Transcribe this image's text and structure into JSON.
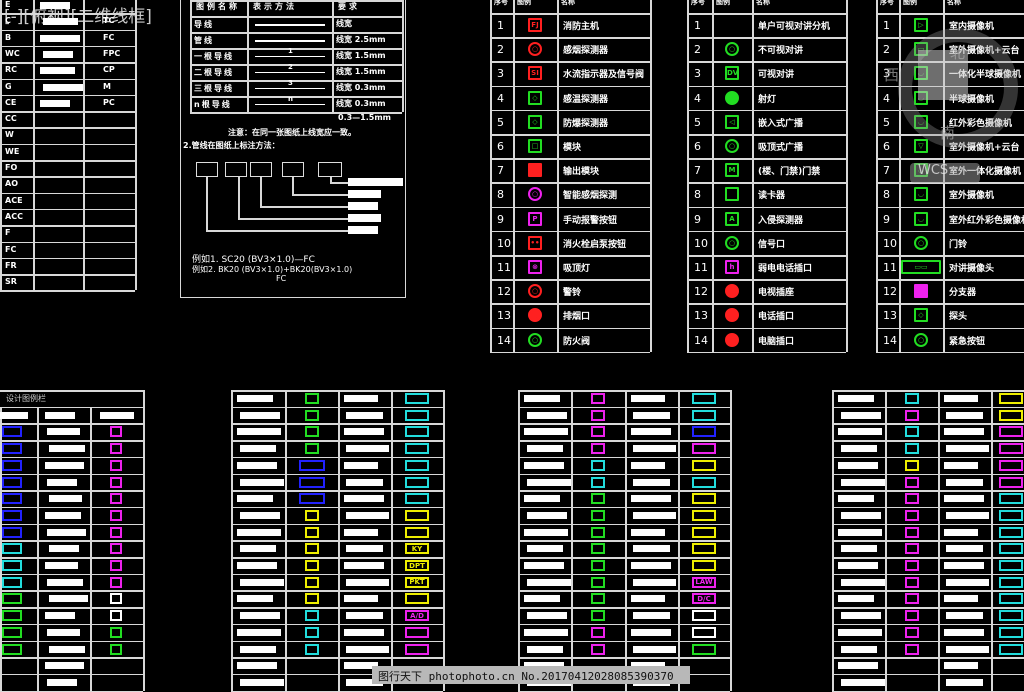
{
  "viewport_label": "[-][俯视][二维线框]",
  "code_table": {
    "left_codes": [
      "E",
      "C",
      "B",
      "WC",
      "RC",
      "G",
      "CE",
      "CC",
      "W",
      "WE",
      "FO",
      "AO",
      "ACE",
      "ACC",
      "F",
      "FC",
      "FR",
      "SR"
    ],
    "right_codes": [
      "",
      "TC",
      "FC",
      "FPC",
      "CP",
      "M",
      "PC"
    ]
  },
  "line_legend": {
    "headers": [
      "图例名称",
      "表示方法",
      "要求"
    ],
    "rows": [
      {
        "name": "导线",
        "req": "线宽"
      },
      {
        "name": "管线",
        "req": "线宽 2.5mm"
      },
      {
        "name": "一根导线",
        "req": "线宽 1.5mm"
      },
      {
        "name": "二根导线",
        "req": "线宽 1.5mm"
      },
      {
        "name": "三根导线",
        "req": "线宽 0.3mm"
      },
      {
        "name": "n根导线",
        "req": "线宽 0.3mm"
      }
    ],
    "row_marks": [
      "",
      "",
      "1",
      "2",
      "3",
      "n"
    ],
    "last_req": "0.3—1.5mm",
    "note": "注意：在同一张图纸上线宽应一致。",
    "section2": "2.管线在图纸上标注方法：",
    "example1": "例如1.  SC20 (BV3×1.0)—FC",
    "example2": "例如2.  BK20 (BV3×1.0)+BK20(BV3×1.0)",
    "example2_sub": "FC"
  },
  "legend_headers": [
    "序号",
    "图例",
    "名称"
  ],
  "legend_tables": [
    {
      "items": [
        {
          "n": "1",
          "name": "消防主机",
          "color": "#ff2020",
          "glyph": "FJ"
        },
        {
          "n": "2",
          "name": "感烟探测器",
          "color": "#ff2020",
          "glyph": "○"
        },
        {
          "n": "3",
          "name": "水流指示器及信号阀",
          "color": "#ff2020",
          "glyph": "SI"
        },
        {
          "n": "4",
          "name": "感温探测器",
          "color": "#22dd22",
          "glyph": "◇"
        },
        {
          "n": "5",
          "name": "防爆探测器",
          "color": "#22dd22",
          "glyph": "◇"
        },
        {
          "n": "6",
          "name": "模块",
          "color": "#22dd22",
          "glyph": "□"
        },
        {
          "n": "7",
          "name": "输出模块",
          "color": "#ff2020",
          "glyph": "■"
        },
        {
          "n": "8",
          "name": "智能感烟探测",
          "color": "#ee22ee",
          "glyph": "○"
        },
        {
          "n": "9",
          "name": "手动报警按钮",
          "color": "#ee22ee",
          "glyph": "P"
        },
        {
          "n": "10",
          "name": "消火栓启泵按钮",
          "color": "#ff2020",
          "glyph": "••"
        },
        {
          "n": "11",
          "name": "吸顶灯",
          "color": "#ee22ee",
          "glyph": "⊗"
        },
        {
          "n": "12",
          "name": "警铃",
          "color": "#ff2020",
          "glyph": "○"
        },
        {
          "n": "13",
          "name": "排烟口",
          "color": "#ff2020",
          "glyph": "●"
        },
        {
          "n": "14",
          "name": "防火阀",
          "color": "#22dd22",
          "glyph": "○"
        }
      ]
    },
    {
      "items": [
        {
          "n": "1",
          "name": "单户可视对讲分机",
          "color": "#22dd22",
          "glyph": ""
        },
        {
          "n": "2",
          "name": "不可视对讲",
          "color": "#22dd22",
          "glyph": "○"
        },
        {
          "n": "3",
          "name": "可视对讲",
          "color": "#22dd22",
          "glyph": "DV"
        },
        {
          "n": "4",
          "name": "射灯",
          "color": "#22dd22",
          "glyph": "●"
        },
        {
          "n": "5",
          "name": "嵌入式广播",
          "color": "#22dd22",
          "glyph": "◁"
        },
        {
          "n": "6",
          "name": "吸顶式广播",
          "color": "#22dd22",
          "glyph": "○"
        },
        {
          "n": "7",
          "name": "(楼、门禁)门禁",
          "color": "#22dd22",
          "glyph": "M"
        },
        {
          "n": "8",
          "name": "读卡器",
          "color": "#22dd22",
          "glyph": ""
        },
        {
          "n": "9",
          "name": "入侵探测器",
          "color": "#22dd22",
          "glyph": "A"
        },
        {
          "n": "10",
          "name": "信号口",
          "color": "#22dd22",
          "glyph": "○"
        },
        {
          "n": "11",
          "name": "弱电电话插口",
          "color": "#ee22ee",
          "glyph": "h"
        },
        {
          "n": "12",
          "name": "电视插座",
          "color": "#ff2020",
          "glyph": "●"
        },
        {
          "n": "13",
          "name": "电话插口",
          "color": "#ff2020",
          "glyph": "●"
        },
        {
          "n": "14",
          "name": "电脑插口",
          "color": "#ff2020",
          "glyph": "●"
        }
      ]
    },
    {
      "items": [
        {
          "n": "1",
          "name": "室内摄像机",
          "color": "#22dd22",
          "glyph": "▷"
        },
        {
          "n": "2",
          "name": "室外摄像机+云台",
          "color": "#22dd22",
          "glyph": "▭"
        },
        {
          "n": "3",
          "name": "一体化半球摄像机",
          "color": "#22dd22",
          "glyph": "◡"
        },
        {
          "n": "4",
          "name": "半球摄像机",
          "color": "#22dd22",
          "glyph": "◡"
        },
        {
          "n": "5",
          "name": "红外彩色摄像机",
          "color": "#22dd22",
          "glyph": "◡"
        },
        {
          "n": "6",
          "name": "室外摄像机+云台",
          "color": "#22dd22",
          "glyph": "▽"
        },
        {
          "n": "7",
          "name": "室外一体化摄像机",
          "color": "#22dd22",
          "glyph": "◡"
        },
        {
          "n": "8",
          "name": "室外摄像机",
          "color": "#22dd22",
          "glyph": "◡"
        },
        {
          "n": "9",
          "name": "室外红外彩色摄像机",
          "color": "#22dd22",
          "glyph": "◡"
        },
        {
          "n": "10",
          "name": "门铃",
          "color": "#22dd22",
          "glyph": "○"
        },
        {
          "n": "11",
          "name": "对讲摄像头",
          "color": "#22dd22",
          "glyph": "▭▭"
        },
        {
          "n": "12",
          "name": "分支器",
          "color": "#ee22ee",
          "glyph": "■"
        },
        {
          "n": "13",
          "name": "探头",
          "color": "#22dd22",
          "glyph": "◇"
        },
        {
          "n": "14",
          "name": "紧急按钮",
          "color": "#22dd22",
          "glyph": "○"
        }
      ]
    }
  ],
  "design_legend_title": "设计图例栏",
  "bottom_tables": [
    {
      "c1": [
        "#2222ff",
        "#2222ff",
        "#2222ff",
        "#2222ff",
        "#2222ff",
        "#2222ff",
        "#2222ff",
        "#22dddd",
        "#22dddd",
        "#22dddd",
        "#22dd22",
        "#22dd22",
        "#22dd22",
        "#22dd22"
      ],
      "c2": [
        "#ee22ee",
        "#ee22ee",
        "#ee22ee",
        "#ee22ee",
        "#ee22ee",
        "#ee22ee",
        "#ee22ee",
        "#ee22ee",
        "#ee22ee",
        "#ee22ee",
        "#ffffff",
        "#ffffff",
        "#22dd22",
        "#22dd22"
      ]
    },
    {
      "c1": [
        "#22dd22",
        "#22dd22",
        "#22dd22",
        "#22dd22",
        "#2222ff",
        "#2222ff",
        "#2222ff",
        "#eeee00",
        "#eeee00",
        "#eeee00",
        "#eeee00",
        "#eeee00",
        "#eeee00",
        "#22dddd",
        "#22dddd",
        "#22dddd"
      ],
      "c2": [
        "#22dddd",
        "#22dddd",
        "#22dddd",
        "#22dddd",
        "#22dddd",
        "#22dddd",
        "#22dddd",
        "#eeee00",
        "#eeee00",
        "#eeee00",
        "#eeee00",
        "#eeee00",
        "#eeee00",
        "#ee22ee",
        "#ee22ee",
        "#ee22ee"
      ],
      "labels": [
        "",
        "",
        "",
        "",
        "",
        "",
        "",
        "",
        "",
        "KY",
        "DPT",
        "PKT",
        "",
        "A/D",
        "",
        ""
      ]
    },
    {
      "c1": [
        "#ee22ee",
        "#ee22ee",
        "#ee22ee",
        "#ee22ee",
        "#22dddd",
        "#22dddd",
        "#22dd22",
        "#22dd22",
        "#22dd22",
        "#22dd22",
        "#22dd22",
        "#22dd22",
        "#22dd22",
        "#22dd22",
        "#ee22ee",
        "#ee22ee"
      ],
      "c2": [
        "#22dddd",
        "#22dddd",
        "#2222ff",
        "#ee22ee",
        "#eeee00",
        "#22dddd",
        "#eeee00",
        "#eeee00",
        "#eeee00",
        "#eeee00",
        "#eeee00",
        "#ee22ee",
        "#ee22ee",
        "#ffffff",
        "#ffffff",
        "#22dd22"
      ],
      "labels": [
        "",
        "",
        "",
        "",
        "",
        "",
        "",
        "",
        "",
        "",
        "",
        "LAW",
        "D/C",
        "",
        "",
        ""
      ]
    },
    {
      "c1": [
        "#22dddd",
        "#ee22ee",
        "#22dddd",
        "#22dddd",
        "#eeee00",
        "#ee22ee",
        "#ee22ee",
        "#ee22ee",
        "#ee22ee",
        "#ee22ee",
        "#ee22ee",
        "#ee22ee",
        "#ee22ee",
        "#ee22ee",
        "#ee22ee",
        "#ee22ee"
      ],
      "c2": [
        "#eeee00",
        "#eeee00",
        "#ee22ee",
        "#ee22ee",
        "#ee22ee",
        "#ee22ee",
        "#22dddd",
        "#22dddd",
        "#22dddd",
        "#22dddd",
        "#22dddd",
        "#22dddd",
        "#22dddd",
        "#22dddd",
        "#22dddd",
        "#22dddd"
      ]
    }
  ],
  "watermark": {
    "footer": "图行天下  photophoto.cn   No.20170412028085390370",
    "logo_text": "WCS",
    "compass": [
      "北",
      "西",
      "南"
    ]
  }
}
